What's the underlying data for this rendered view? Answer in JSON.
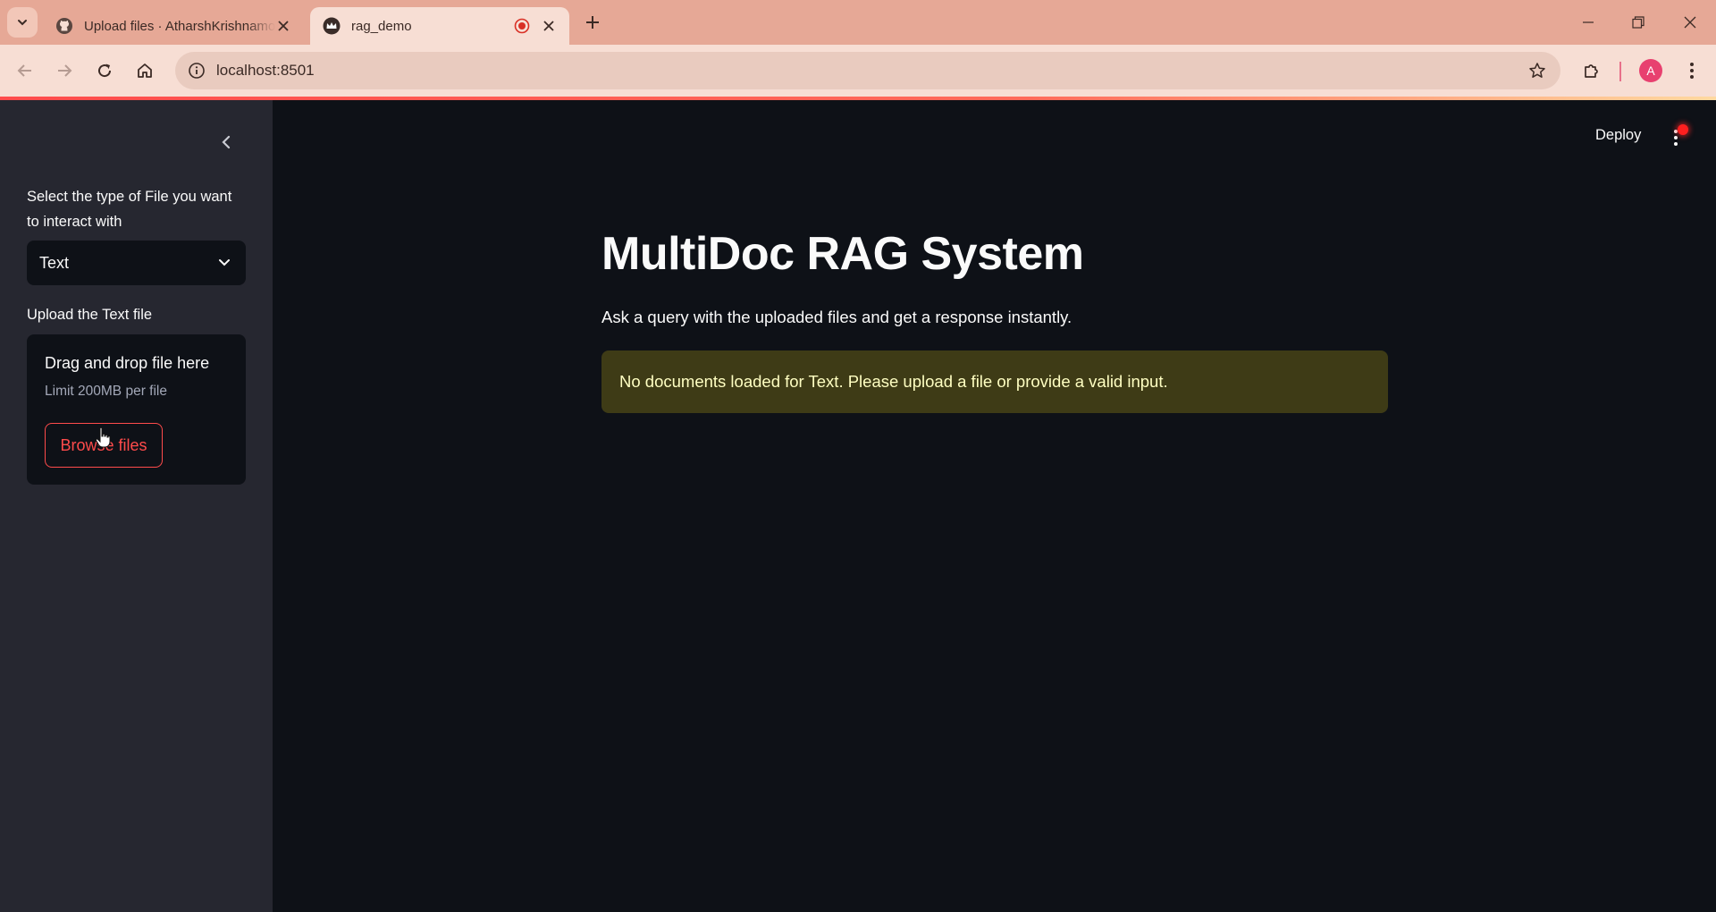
{
  "browser": {
    "tabs": [
      {
        "title": "Upload files · AtharshKrishnamoorthy",
        "favicon": "github-icon",
        "active": false
      },
      {
        "title": "rag_demo",
        "favicon": "streamlit-crown-icon",
        "active": true
      }
    ],
    "url": "localhost:8501",
    "profile_initial": "A",
    "accent_color": "#e6a896"
  },
  "sidebar": {
    "select_label": "Select the type of File you want to interact with",
    "select_value": "Text",
    "upload_label": "Upload the Text file",
    "dropzone": {
      "title": "Drag and drop file here",
      "limit": "Limit 200MB per file",
      "browse_label": "Browse files"
    }
  },
  "header": {
    "deploy_label": "Deploy"
  },
  "main": {
    "title": "MultiDoc RAG System",
    "subtitle": "Ask a query with the uploaded files and get a response instantly.",
    "alert": "No documents loaded for Text. Please upload a file or provide a valid input."
  },
  "colors": {
    "app_bg": "#0e1117",
    "sidebar_bg": "#262730",
    "primary": "#ff4b4b",
    "warning_bg": "#3e3b16",
    "warning_text": "#ffffc2"
  }
}
